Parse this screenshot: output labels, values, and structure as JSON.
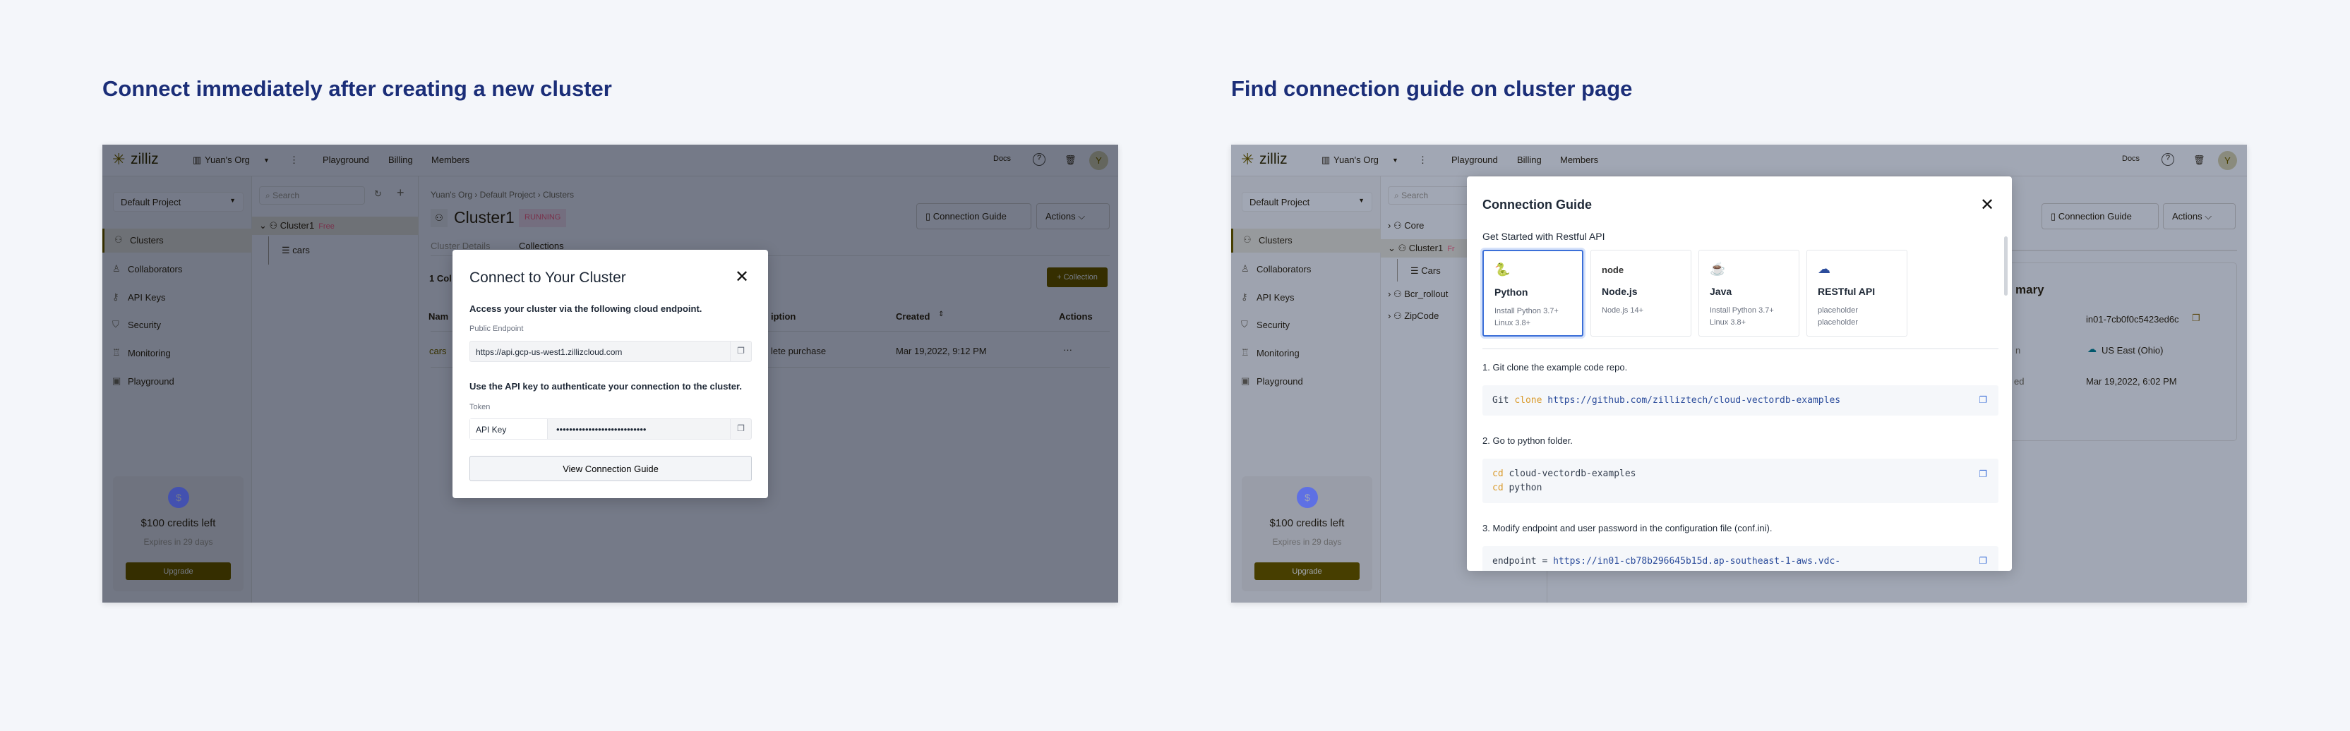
{
  "headings": {
    "left": "Connect immediately after creating a new cluster",
    "right": "Find connection guide on cluster page"
  },
  "app": {
    "logo": "zilliz",
    "org": "Yuan's Org",
    "nav": [
      "Playground",
      "Billing",
      "Members"
    ],
    "docs": "Docs",
    "avatar": "Y",
    "project": "Default Project",
    "sidebar": [
      {
        "label": "Clusters",
        "icon": "clusters-icon"
      },
      {
        "label": "Collaborators",
        "icon": "user-icon"
      },
      {
        "label": "API Keys",
        "icon": "key-icon"
      },
      {
        "label": "Security",
        "icon": "shield-icon"
      },
      {
        "label": "Monitoring",
        "icon": "monitor-icon"
      },
      {
        "label": "Playground",
        "icon": "terminal-icon"
      }
    ],
    "credits": {
      "coin": "$",
      "amount": "$100 credits left",
      "expires": "Expires in 29 days",
      "upgrade": "Upgrade"
    },
    "search_placeholder": "Search",
    "connection_guide_btn": "Connection Guide",
    "actions_btn": "Actions"
  },
  "left": {
    "tree": [
      {
        "label": "Cluster1",
        "badge": "Free"
      },
      {
        "label": "cars"
      }
    ],
    "breadcrumb": "Yuan's Org › Default Project › Clusters",
    "cluster_title": "Cluster1",
    "status": "RUNNING",
    "tabs": [
      "Cluster Details",
      "Collections"
    ],
    "count_fragment": "1 Col",
    "add_collection": "+ Collection",
    "table": {
      "headers": [
        "Nam",
        "iption",
        "Created",
        "Actions"
      ],
      "row": [
        "cars",
        "lete purchase",
        "Mar 19,2022, 9:12 PM",
        "···"
      ]
    },
    "modal": {
      "title": "Connect to Your Cluster",
      "endpoint_desc": "Access your cluster via the following cloud endpoint.",
      "endpoint_label": "Public Endpoint",
      "endpoint_value": "https://api.gcp-us-west1.zillizcloud.com",
      "token_desc": "Use the API key to authenticate your connection to the cluster.",
      "token_label": "Token",
      "token_type": "API Key",
      "token_value": "••••••••••••••••••••••••••••",
      "button": "View Connection Guide"
    }
  },
  "right": {
    "tree": [
      {
        "label": "Core"
      },
      {
        "label": "Cluster1",
        "badge": "Fr"
      },
      {
        "label": "Cars"
      },
      {
        "label": "Bcr_rollout"
      },
      {
        "label": "ZipCode"
      }
    ],
    "summary": {
      "title_fragment": "mary",
      "rows": [
        {
          "label": "",
          "value": "in01-7cb0f0c5423ed6c"
        },
        {
          "label": "n",
          "value": "US East (Ohio)"
        },
        {
          "label": "ed",
          "value": "Mar 19,2022, 6:02 PM"
        }
      ]
    },
    "modal": {
      "title": "Connection Guide",
      "subtitle": "Get Started with Restful API",
      "cards": [
        {
          "name": "Python",
          "desc": "Install Python 3.7+\nLinux 3.8+",
          "icon": "python-icon",
          "selected": true
        },
        {
          "name": "Node.js",
          "desc": "Node.js 14+",
          "icon": "nodejs-icon"
        },
        {
          "name": "Java",
          "desc": "Install Python 3.7+\nLinux 3.8+",
          "icon": "java-icon"
        },
        {
          "name": "RESTful API",
          "desc": "placeholder\nplaceholder",
          "icon": "api-cloud-icon"
        }
      ],
      "steps": [
        "1. Git clone the example code repo.",
        "2. Go to python folder.",
        "3. Modify endpoint and user password in the configuration file (conf.ini)."
      ],
      "code": {
        "c1": {
          "a": "Git",
          "b": "clone",
          "c": "https://github.com/zilliztech/cloud-vectordb-examples"
        },
        "c2": {
          "k1": "cd",
          "v1": "cloud-vectordb-examples",
          "k2": "cd",
          "v2": "python"
        },
        "c3": {
          "a": "endpoint",
          "b": "=",
          "c": "https://in01-cb78b296645b15d.ap-southeast-1-aws.vdc-"
        }
      }
    }
  },
  "colors": {
    "heading": "#1b2e78",
    "accent": "#3557d6",
    "overlay_left": "rgba(38,46,62,0.82)",
    "overlay_right": "rgba(38,46,62,0.6)"
  }
}
